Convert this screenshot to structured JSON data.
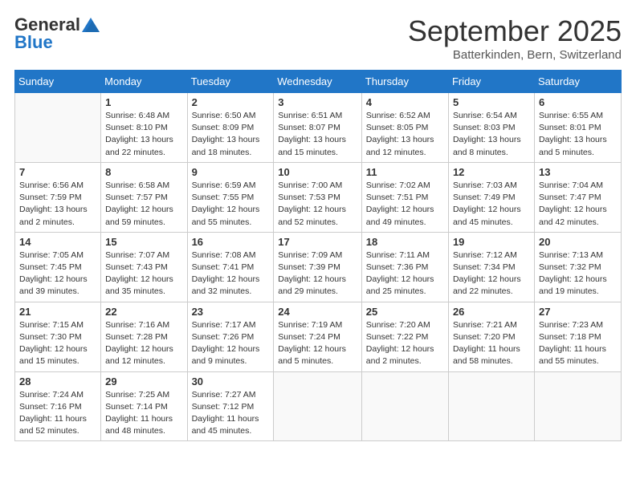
{
  "header": {
    "logo_general": "General",
    "logo_blue": "Blue",
    "month_title": "September 2025",
    "location": "Batterkinden, Bern, Switzerland"
  },
  "weekdays": [
    "Sunday",
    "Monday",
    "Tuesday",
    "Wednesday",
    "Thursday",
    "Friday",
    "Saturday"
  ],
  "weeks": [
    [
      {
        "day": "",
        "info": ""
      },
      {
        "day": "1",
        "info": "Sunrise: 6:48 AM\nSunset: 8:10 PM\nDaylight: 13 hours\nand 22 minutes."
      },
      {
        "day": "2",
        "info": "Sunrise: 6:50 AM\nSunset: 8:09 PM\nDaylight: 13 hours\nand 18 minutes."
      },
      {
        "day": "3",
        "info": "Sunrise: 6:51 AM\nSunset: 8:07 PM\nDaylight: 13 hours\nand 15 minutes."
      },
      {
        "day": "4",
        "info": "Sunrise: 6:52 AM\nSunset: 8:05 PM\nDaylight: 13 hours\nand 12 minutes."
      },
      {
        "day": "5",
        "info": "Sunrise: 6:54 AM\nSunset: 8:03 PM\nDaylight: 13 hours\nand 8 minutes."
      },
      {
        "day": "6",
        "info": "Sunrise: 6:55 AM\nSunset: 8:01 PM\nDaylight: 13 hours\nand 5 minutes."
      }
    ],
    [
      {
        "day": "7",
        "info": "Sunrise: 6:56 AM\nSunset: 7:59 PM\nDaylight: 13 hours\nand 2 minutes."
      },
      {
        "day": "8",
        "info": "Sunrise: 6:58 AM\nSunset: 7:57 PM\nDaylight: 12 hours\nand 59 minutes."
      },
      {
        "day": "9",
        "info": "Sunrise: 6:59 AM\nSunset: 7:55 PM\nDaylight: 12 hours\nand 55 minutes."
      },
      {
        "day": "10",
        "info": "Sunrise: 7:00 AM\nSunset: 7:53 PM\nDaylight: 12 hours\nand 52 minutes."
      },
      {
        "day": "11",
        "info": "Sunrise: 7:02 AM\nSunset: 7:51 PM\nDaylight: 12 hours\nand 49 minutes."
      },
      {
        "day": "12",
        "info": "Sunrise: 7:03 AM\nSunset: 7:49 PM\nDaylight: 12 hours\nand 45 minutes."
      },
      {
        "day": "13",
        "info": "Sunrise: 7:04 AM\nSunset: 7:47 PM\nDaylight: 12 hours\nand 42 minutes."
      }
    ],
    [
      {
        "day": "14",
        "info": "Sunrise: 7:05 AM\nSunset: 7:45 PM\nDaylight: 12 hours\nand 39 minutes."
      },
      {
        "day": "15",
        "info": "Sunrise: 7:07 AM\nSunset: 7:43 PM\nDaylight: 12 hours\nand 35 minutes."
      },
      {
        "day": "16",
        "info": "Sunrise: 7:08 AM\nSunset: 7:41 PM\nDaylight: 12 hours\nand 32 minutes."
      },
      {
        "day": "17",
        "info": "Sunrise: 7:09 AM\nSunset: 7:39 PM\nDaylight: 12 hours\nand 29 minutes."
      },
      {
        "day": "18",
        "info": "Sunrise: 7:11 AM\nSunset: 7:36 PM\nDaylight: 12 hours\nand 25 minutes."
      },
      {
        "day": "19",
        "info": "Sunrise: 7:12 AM\nSunset: 7:34 PM\nDaylight: 12 hours\nand 22 minutes."
      },
      {
        "day": "20",
        "info": "Sunrise: 7:13 AM\nSunset: 7:32 PM\nDaylight: 12 hours\nand 19 minutes."
      }
    ],
    [
      {
        "day": "21",
        "info": "Sunrise: 7:15 AM\nSunset: 7:30 PM\nDaylight: 12 hours\nand 15 minutes."
      },
      {
        "day": "22",
        "info": "Sunrise: 7:16 AM\nSunset: 7:28 PM\nDaylight: 12 hours\nand 12 minutes."
      },
      {
        "day": "23",
        "info": "Sunrise: 7:17 AM\nSunset: 7:26 PM\nDaylight: 12 hours\nand 9 minutes."
      },
      {
        "day": "24",
        "info": "Sunrise: 7:19 AM\nSunset: 7:24 PM\nDaylight: 12 hours\nand 5 minutes."
      },
      {
        "day": "25",
        "info": "Sunrise: 7:20 AM\nSunset: 7:22 PM\nDaylight: 12 hours\nand 2 minutes."
      },
      {
        "day": "26",
        "info": "Sunrise: 7:21 AM\nSunset: 7:20 PM\nDaylight: 11 hours\nand 58 minutes."
      },
      {
        "day": "27",
        "info": "Sunrise: 7:23 AM\nSunset: 7:18 PM\nDaylight: 11 hours\nand 55 minutes."
      }
    ],
    [
      {
        "day": "28",
        "info": "Sunrise: 7:24 AM\nSunset: 7:16 PM\nDaylight: 11 hours\nand 52 minutes."
      },
      {
        "day": "29",
        "info": "Sunrise: 7:25 AM\nSunset: 7:14 PM\nDaylight: 11 hours\nand 48 minutes."
      },
      {
        "day": "30",
        "info": "Sunrise: 7:27 AM\nSunset: 7:12 PM\nDaylight: 11 hours\nand 45 minutes."
      },
      {
        "day": "",
        "info": ""
      },
      {
        "day": "",
        "info": ""
      },
      {
        "day": "",
        "info": ""
      },
      {
        "day": "",
        "info": ""
      }
    ]
  ]
}
